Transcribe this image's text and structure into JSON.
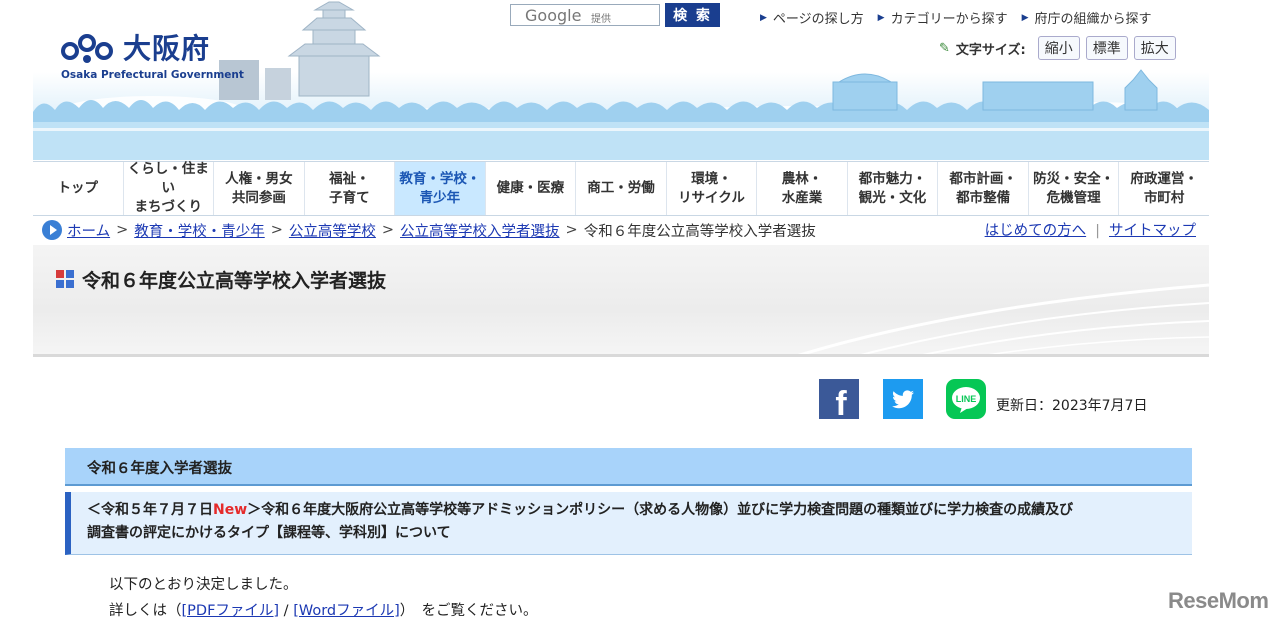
{
  "header": {
    "logo_jp": "大阪府",
    "logo_en": "Osaka Prefectural Government",
    "search_brand": "Google",
    "search_provider": "提供",
    "search_button": "検 索",
    "top_links": [
      "ページの探し方",
      "カテゴリーから探す",
      "府庁の組織から探す"
    ],
    "font_size_label": "文字サイズ:",
    "font_size_options": [
      "縮小",
      "標準",
      "拡大"
    ]
  },
  "nav": {
    "items": [
      {
        "label": "トップ"
      },
      {
        "label": "くらし・住まい\nまちづくり"
      },
      {
        "label": "人権・男女\n共同参画"
      },
      {
        "label": "福祉・\n子育て"
      },
      {
        "label": "教育・学校・\n青少年",
        "active": true
      },
      {
        "label": "健康・医療"
      },
      {
        "label": "商工・労働"
      },
      {
        "label": "環境・\nリサイクル"
      },
      {
        "label": "農林・\n水産業"
      },
      {
        "label": "都市魅力・\n観光・文化"
      },
      {
        "label": "都市計画・\n都市整備"
      },
      {
        "label": "防災・安全・\n危機管理"
      },
      {
        "label": "府政運営・\n市町村"
      }
    ]
  },
  "breadcrumb": {
    "links": [
      "ホーム",
      "教育・学校・青少年",
      "公立高等学校",
      "公立高等学校入学者選抜"
    ],
    "separator": ">",
    "current": "令和６年度公立高等学校入学者選抜",
    "util_links": [
      "はじめての方へ",
      "サイトマップ"
    ]
  },
  "page": {
    "title": "令和６年度公立高等学校入学者選抜",
    "updated": "更新日：2023年7月7日",
    "section_title": "令和６年度入学者選抜",
    "sub": {
      "prefix": "＜令和５年７月７日",
      "new_label": "New",
      "rest": "＞令和６年度大阪府公立高等学校等アドミッションポリシー（求める人物像）並びに学力検査問題の種類並びに学力検査の成績及び",
      "line2": "調査書の評定にかけるタイプ【課程等、学科別】について"
    },
    "body_line1": "以下のとおり決定しました。",
    "body_line2_prefix": "詳しくは（",
    "pdf_link": "[PDFファイル]",
    "slash": " / ",
    "word_link": "[Wordファイル]",
    "body_line2_suffix": "）　をご覧ください。"
  },
  "social": {
    "facebook": "f",
    "line": "LINE"
  },
  "watermark": "ReseMom",
  "colors": {
    "brand_blue": "#1a3e8f",
    "nav_active_bg": "#c9e8ff",
    "section_bg": "#a8d3fa",
    "sub_bg": "#e3f0fd",
    "new_red": "#e52a2a",
    "link": "#1c39b3"
  },
  "icons": {
    "logo_mark": "osaka-mark-icon",
    "search_arrow": "triangle-arrow-icon",
    "pen": "pen-icon",
    "breadcrumb": "circle-arrow-icon",
    "title_mark": "four-squares-icon",
    "facebook": "facebook-icon",
    "twitter": "twitter-bird-icon",
    "line": "line-icon"
  }
}
